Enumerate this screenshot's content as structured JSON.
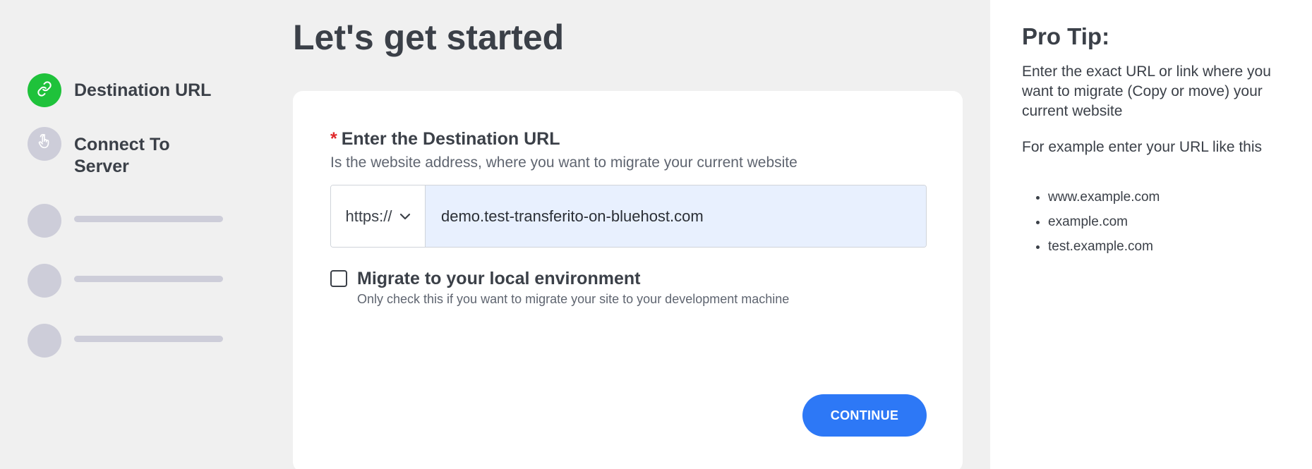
{
  "stepper": {
    "steps": [
      {
        "label": "Destination URL",
        "status": "active",
        "icon": "link-icon"
      },
      {
        "label": "Connect To",
        "label2": "Server",
        "status": "pending",
        "icon": "hand-pointer-icon"
      },
      {
        "label": "",
        "status": "placeholder"
      },
      {
        "label": "",
        "status": "placeholder"
      },
      {
        "label": "",
        "status": "placeholder"
      }
    ]
  },
  "main": {
    "title": "Let's get started",
    "field": {
      "required_mark": "*",
      "label": "Enter the Destination URL",
      "help": "Is the website address, where you want to migrate your current website",
      "protocol": "https://",
      "value": "demo.test-transferito-on-bluehost.com"
    },
    "checkbox": {
      "label": "Migrate to your local environment",
      "help": "Only check this if you want to migrate your site to your development machine",
      "checked": false
    },
    "continue_label": "CONTINUE"
  },
  "tip": {
    "title": "Pro Tip:",
    "text1": "Enter the exact URL or link where you want to migrate (Copy or move) your current website",
    "text2": "For example enter your URL like this",
    "examples": [
      "www.example.com",
      "example.com",
      "test.example.com"
    ]
  },
  "colors": {
    "active_step": "#1fc23b",
    "pending_step": "#cdcdd9",
    "primary": "#2d78f6",
    "required": "#e0282a",
    "input_fill": "#e8f0fe"
  }
}
